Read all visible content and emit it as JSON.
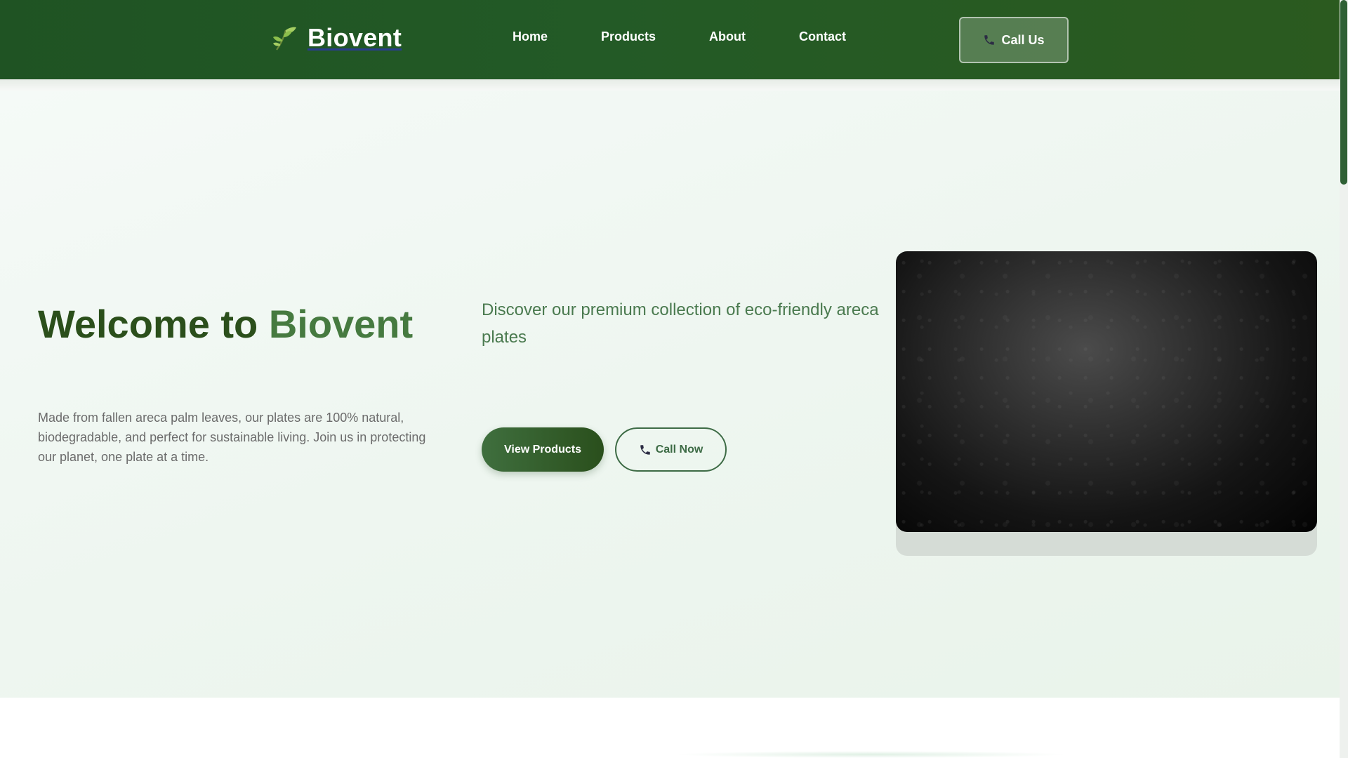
{
  "header": {
    "brand": "Biovent",
    "logo_icon": "leaf-icon",
    "nav": [
      {
        "label": "Home"
      },
      {
        "label": "Products"
      },
      {
        "label": "About"
      },
      {
        "label": "Contact"
      }
    ],
    "call_button": {
      "label": "Call Us",
      "icon": "phone-icon"
    }
  },
  "hero": {
    "title_prefix": "Welcome to ",
    "title_accent": "Biovent",
    "subtitle": "Discover our premium collection of eco-friendly areca plates",
    "description": "Made from fallen areca palm leaves, our plates are 100% natural, biodegradable, and perfect for sustainable living. Join us in protecting our planet, one plate at a time.",
    "primary_button": "View Products",
    "secondary_button": {
      "label": "Call Now",
      "icon": "phone-icon"
    }
  },
  "colors": {
    "header_green": "#1f5323",
    "title_green": "#2b4f1b",
    "accent_green": "#467a40",
    "subtitle_green": "#4a7a4f"
  }
}
